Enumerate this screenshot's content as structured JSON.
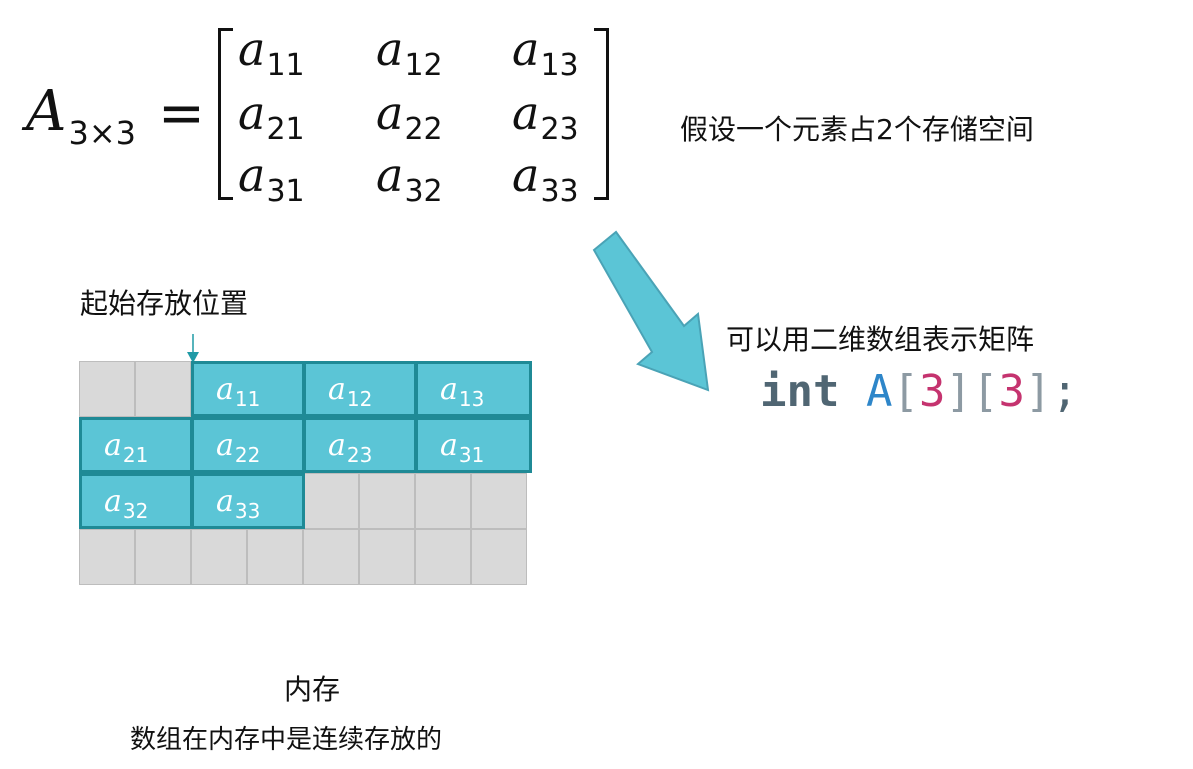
{
  "matrix": {
    "lhs_symbol": "A",
    "lhs_subscript": "3×3",
    "equals": "=",
    "elements": [
      {
        "symbol": "a",
        "sub": "11"
      },
      {
        "symbol": "a",
        "sub": "12"
      },
      {
        "symbol": "a",
        "sub": "13"
      },
      {
        "symbol": "a",
        "sub": "21"
      },
      {
        "symbol": "a",
        "sub": "22"
      },
      {
        "symbol": "a",
        "sub": "23"
      },
      {
        "symbol": "a",
        "sub": "31"
      },
      {
        "symbol": "a",
        "sub": "32"
      },
      {
        "symbol": "a",
        "sub": "33"
      }
    ]
  },
  "texts": {
    "assume": "假设一个元素占2个存储空间",
    "start_label": "起始存放位置",
    "represent": "可以用二维数组表示矩阵",
    "memory_label": "内存",
    "contiguous": "数组在内存中是连续存放的"
  },
  "code": {
    "keyword": "int",
    "identifier": "A",
    "open1": "[",
    "n1": "3",
    "close1": "]",
    "open2": "[",
    "n2": "3",
    "close2": "]",
    "semicolon": ";"
  },
  "memory": {
    "elements": [
      {
        "symbol": "a",
        "sub": "11"
      },
      {
        "symbol": "a",
        "sub": "12"
      },
      {
        "symbol": "a",
        "sub": "13"
      },
      {
        "symbol": "a",
        "sub": "21"
      },
      {
        "symbol": "a",
        "sub": "22"
      },
      {
        "symbol": "a",
        "sub": "23"
      },
      {
        "symbol": "a",
        "sub": "31"
      },
      {
        "symbol": "a",
        "sub": "32"
      },
      {
        "symbol": "a",
        "sub": "33"
      }
    ]
  },
  "colors": {
    "element_fill": "#5bc5d6",
    "element_border": "#1f8a96",
    "memory_cell": "#d9d9d9",
    "arrow_fill": "#5bc5d6",
    "keyword": "#506673",
    "identifier": "#2e86c9",
    "number": "#c5336f"
  },
  "icons": {
    "start_marker": "down-arrow-icon",
    "transition": "diagonal-arrow-icon"
  }
}
